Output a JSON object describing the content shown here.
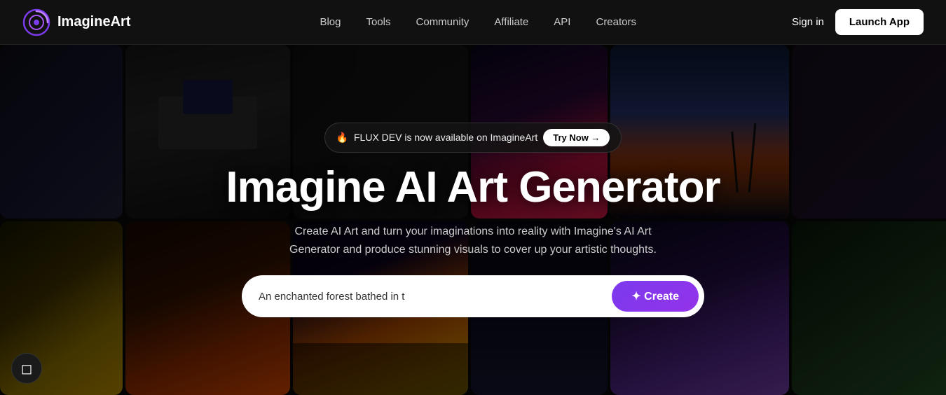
{
  "nav": {
    "logo_text": "ImagineArt",
    "links": [
      {
        "label": "Blog",
        "key": "blog"
      },
      {
        "label": "Tools",
        "key": "tools"
      },
      {
        "label": "Community",
        "key": "community"
      },
      {
        "label": "Affiliate",
        "key": "affiliate"
      },
      {
        "label": "API",
        "key": "api"
      },
      {
        "label": "Creators",
        "key": "creators"
      }
    ],
    "sign_in": "Sign in",
    "launch_app": "Launch App"
  },
  "hero": {
    "badge_text": "FLUX DEV is now available on ImagineArt",
    "badge_emoji": "🔥",
    "try_now": "Try Now →",
    "title": "Imagine AI Art Generator",
    "subtitle": "Create AI Art and turn your imaginations into reality with Imagine's AI Art Generator and produce stunning visuals to cover up your artistic thoughts.",
    "search_placeholder": "An enchanted forest bathed in t",
    "create_label": "✦ Create"
  },
  "chat": {
    "icon": "💬"
  }
}
